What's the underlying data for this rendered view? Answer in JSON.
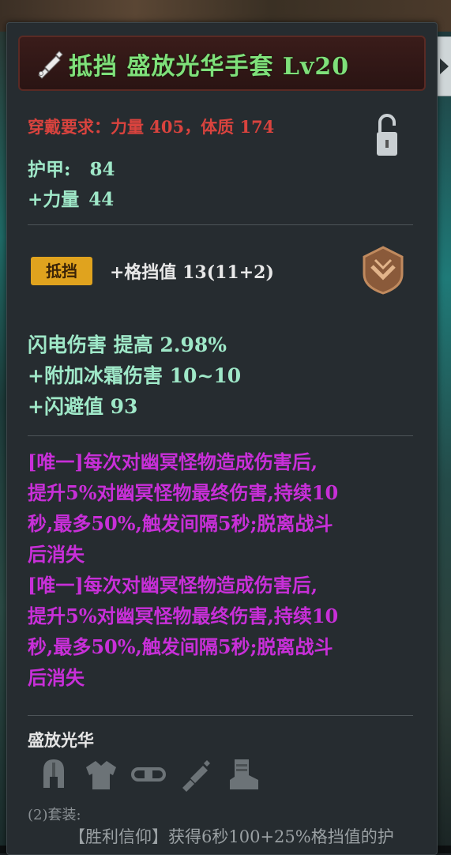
{
  "item": {
    "title": "抵挡 盛放光华手套 Lv20",
    "requirement": "穿戴要求：力量 405，体质 174",
    "lock_icon": "lock-icon",
    "base_stats": [
      {
        "label": "护甲:",
        "value": "84"
      },
      {
        "label": "+力量",
        "value": "44"
      }
    ],
    "block": {
      "badge": "抵挡",
      "text": "+格挡值 13(11+2)",
      "icon": "shield-emblem-icon"
    },
    "magic_stats": [
      "闪电伤害 提高 2.98%",
      "+附加冰霜伤害 10~10",
      "+闪避值 93"
    ],
    "unique_effects": [
      [
        "[唯一]每次对幽冥怪物造成伤害后,",
        "提升5%对幽冥怪物最终伤害,持续10",
        "秒,最多50%,触发间隔5秒;脱离战斗",
        "后消失"
      ],
      [
        "[唯一]每次对幽冥怪物造成伤害后,",
        "提升5%对幽冥怪物最终伤害,持续10",
        "秒,最多50%,触发间隔5秒;脱离战斗",
        "后消失"
      ]
    ],
    "set": {
      "name": "盛放光华",
      "pieces": [
        "helmet-icon",
        "armor-icon",
        "belt-icon",
        "gloves-icon",
        "boots-icon"
      ],
      "bonus_label": "(2)套装:",
      "bonus_text": "【胜利信仰】获得6秒100+25%格挡值的护"
    }
  },
  "colors": {
    "title": "#7fe07a",
    "requirement": "#d9433e",
    "stats": "#9fe8c8",
    "unique": "#c82fd8",
    "badge": "#e0a31e"
  }
}
